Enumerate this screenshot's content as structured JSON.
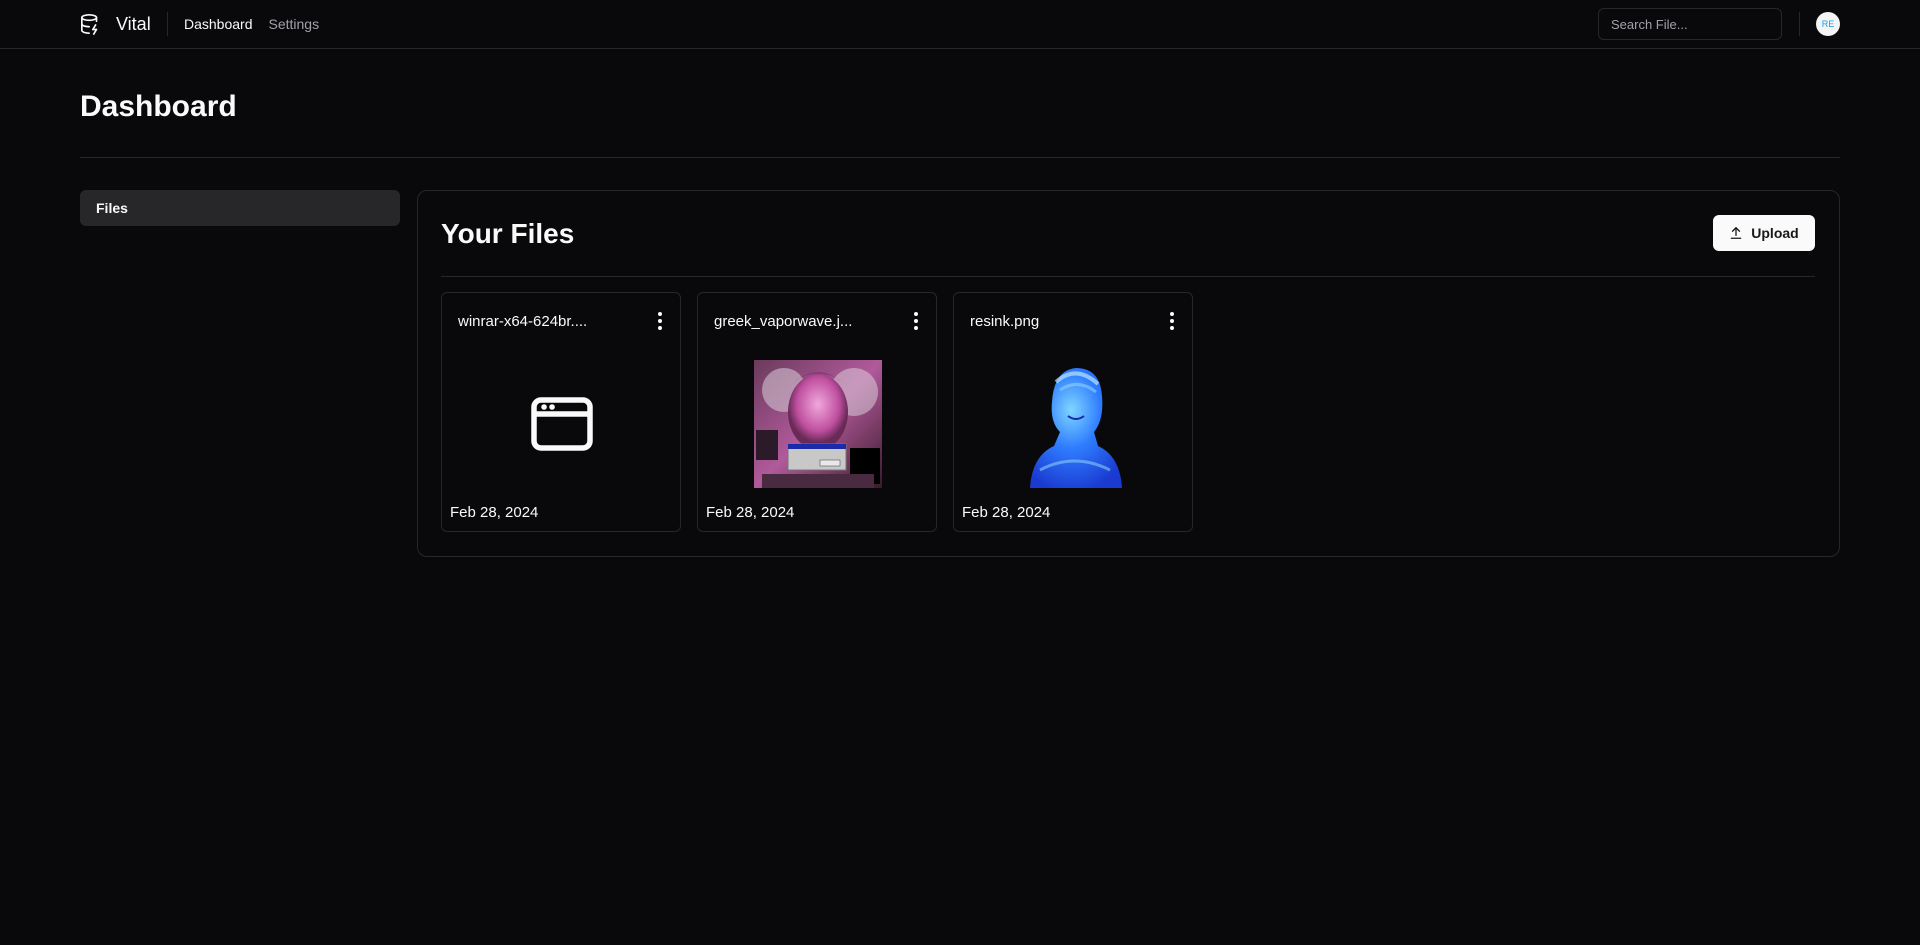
{
  "app": {
    "name": "Vital",
    "brand_icon": "database-zap-icon"
  },
  "nav": {
    "dashboard": "Dashboard",
    "settings": "Settings"
  },
  "search": {
    "placeholder": "Search File..."
  },
  "user": {
    "initials": "RE"
  },
  "page": {
    "title": "Dashboard"
  },
  "sidebar": {
    "items": [
      {
        "label": "Files"
      }
    ]
  },
  "files_panel": {
    "title": "Your Files",
    "upload_label": "Upload",
    "upload_icon": "upload-icon"
  },
  "files": [
    {
      "name": "winrar-x64-624br....",
      "date": "Feb 28, 2024",
      "preview": "app-window-icon"
    },
    {
      "name": "greek_vaporwave.j...",
      "date": "Feb 28, 2024",
      "preview": "image-thumbnail"
    },
    {
      "name": "resink.png",
      "date": "Feb 28, 2024",
      "preview": "image-thumbnail"
    }
  ],
  "colors": {
    "background": "#09090b",
    "border": "#27272a",
    "foreground": "#fafafa",
    "muted": "#a1a1aa",
    "accent_blue": "#0ea5e9"
  }
}
